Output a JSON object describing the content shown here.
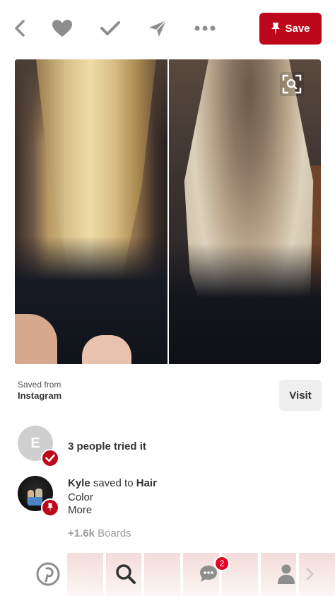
{
  "toolbar": {
    "back_icon": "chevron-left-icon",
    "heart_icon": "heart-icon",
    "check_icon": "checkmark-icon",
    "send_icon": "send-icon",
    "more_icon": "more-horizontal-icon",
    "save_label": "Save",
    "save_color": "#bd081c"
  },
  "pin": {
    "expand_icon": "expand-search-icon"
  },
  "source": {
    "label": "Saved from",
    "name": "Instagram",
    "visit_label": "Visit"
  },
  "tried": {
    "avatar_initial": "E",
    "text": "3 people tried it"
  },
  "saved": {
    "user": "Kyle",
    "action": " saved to ",
    "board": "Hair",
    "board_rest": "Color\nMore",
    "boards_count": "+1.6k",
    "boards_label": " Boards"
  },
  "bottom_nav": {
    "home_icon": "pinterest-logo-icon",
    "search_icon": "search-icon",
    "notifications_icon": "chat-bubble-icon",
    "notifications_count": "2",
    "profile_icon": "person-icon"
  }
}
